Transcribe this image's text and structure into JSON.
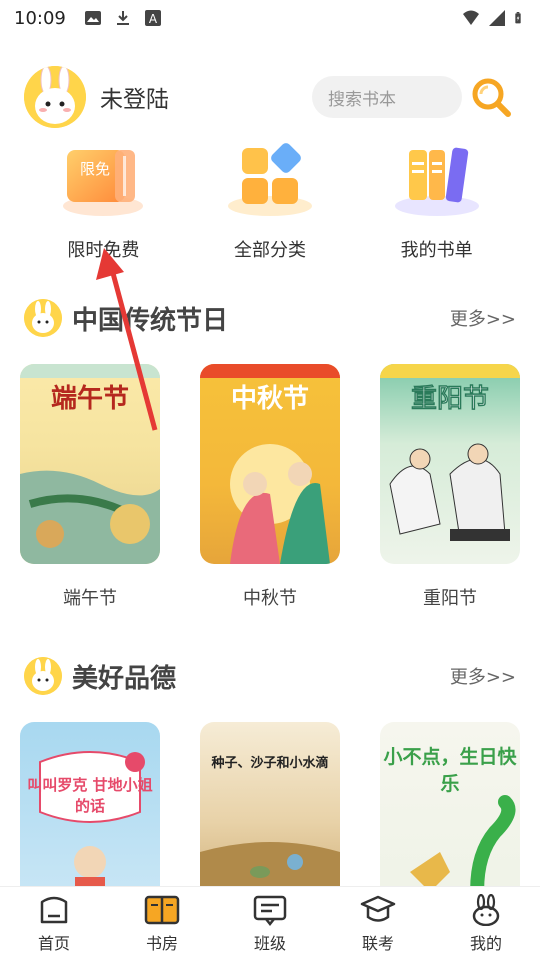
{
  "status_bar": {
    "time": "10:09",
    "left_icons": [
      "image-icon",
      "download-icon",
      "a-icon"
    ],
    "right_icons": [
      "wifi-icon",
      "signal-icon",
      "battery-icon"
    ]
  },
  "header": {
    "username": "未登陆",
    "search_placeholder": "搜索书本"
  },
  "quick_menu": [
    {
      "label": "限时免费",
      "icon": "free-tag-icon",
      "badge": "限免"
    },
    {
      "label": "全部分类",
      "icon": "category-icon"
    },
    {
      "label": "我的书单",
      "icon": "booklist-icon"
    }
  ],
  "sections": [
    {
      "title": "中国传统节日",
      "more": "更多>>",
      "books": [
        {
          "label": "端午节",
          "cover_title": "端午节"
        },
        {
          "label": "中秋节",
          "cover_title": "中秋节"
        },
        {
          "label": "重阳节",
          "cover_title": "重阳节"
        }
      ]
    },
    {
      "title": "美好品德",
      "more": "更多>>",
      "books": [
        {
          "label": "",
          "cover_title": "叫叫罗克 甘地小姐的话"
        },
        {
          "label": "",
          "cover_title": "种子、沙子和小水滴"
        },
        {
          "label": "",
          "cover_title": "小不点，生日快乐"
        }
      ]
    }
  ],
  "bottom_nav": [
    {
      "label": "首页",
      "icon": "home-icon"
    },
    {
      "label": "书房",
      "icon": "book-icon",
      "active": true
    },
    {
      "label": "班级",
      "icon": "class-icon"
    },
    {
      "label": "联考",
      "icon": "exam-icon"
    },
    {
      "label": "我的",
      "icon": "rabbit-icon"
    }
  ],
  "colors": {
    "accent": "#f6a623",
    "active_nav": "#f6a623"
  }
}
